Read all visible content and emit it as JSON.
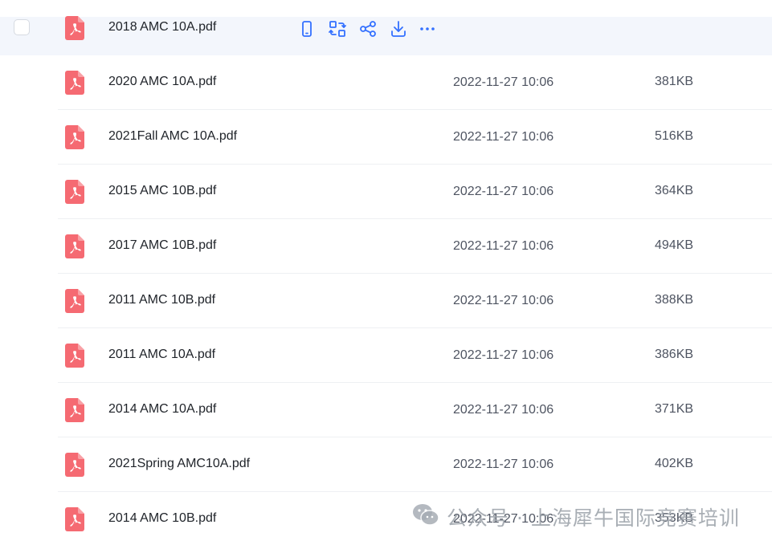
{
  "files": [
    {
      "name": "2018 AMC 10A.pdf",
      "date": "",
      "size": ""
    },
    {
      "name": "2020 AMC 10A.pdf",
      "date": "2022-11-27 10:06",
      "size": "381KB"
    },
    {
      "name": "2021Fall AMC 10A.pdf",
      "date": "2022-11-27 10:06",
      "size": "516KB"
    },
    {
      "name": "2015 AMC 10B.pdf",
      "date": "2022-11-27 10:06",
      "size": "364KB"
    },
    {
      "name": "2017 AMC 10B.pdf",
      "date": "2022-11-27 10:06",
      "size": "494KB"
    },
    {
      "name": "2011 AMC 10B.pdf",
      "date": "2022-11-27 10:06",
      "size": "388KB"
    },
    {
      "name": "2011 AMC 10A.pdf",
      "date": "2022-11-27 10:06",
      "size": "386KB"
    },
    {
      "name": "2014 AMC 10A.pdf",
      "date": "2022-11-27 10:06",
      "size": "371KB"
    },
    {
      "name": "2021Spring AMC10A.pdf",
      "date": "2022-11-27 10:06",
      "size": "402KB"
    },
    {
      "name": "2014 AMC 10B.pdf",
      "date": "2022-11-27 10:06",
      "size": "353KB"
    }
  ],
  "hover_actions": [
    "phone-icon",
    "convert-icon",
    "share-icon",
    "download-icon",
    "more-icon"
  ],
  "watermark": {
    "text": "公众号 · 上海犀牛国际竞赛培训"
  },
  "colors": {
    "pdf_red": "#f56a72",
    "action_blue": "#3370ff",
    "hover_bg": "#f3f6fc"
  }
}
